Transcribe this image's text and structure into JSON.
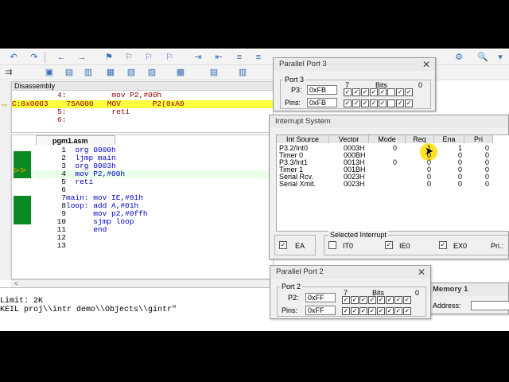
{
  "disassembly": {
    "title": "Disassembly",
    "lines": [
      {
        "text": "          4:          mov P2,#00h"
      },
      {
        "text": "C:0x0003    75A000   MOV       P2(0xA0"
      },
      {
        "text": "          5:          reti"
      },
      {
        "text": "          6:"
      }
    ]
  },
  "editor": {
    "tab_label": "pgm1.asm",
    "lines": [
      {
        "num": "1",
        "code": "  org 0000h"
      },
      {
        "num": "2",
        "code": "  ljmp main"
      },
      {
        "num": "3",
        "code": "  org 0003h"
      },
      {
        "num": "4",
        "code": "  mov P2,#00h"
      },
      {
        "num": "5",
        "code": "  reti"
      },
      {
        "num": "6",
        "code": ""
      },
      {
        "num": "7",
        "code": "main: mov IE,#81h"
      },
      {
        "num": "8",
        "code": "loop: add A,#01h"
      },
      {
        "num": "9",
        "code": "      mov p2,#0ffh"
      },
      {
        "num": "10",
        "code": "      sjmp loop"
      },
      {
        "num": "11",
        "code": "      end"
      },
      {
        "num": "12",
        "code": ""
      },
      {
        "num": "13",
        "code": ""
      }
    ]
  },
  "output": {
    "lines": [
      {
        "text": "Limit: 2K"
      },
      {
        "text": "KEIL proj\\\\intr demo\\\\Objects\\\\gintr\""
      }
    ]
  },
  "port3": {
    "title": "Parallel Port 3",
    "group": "Port 3",
    "reg_label": "P3:",
    "reg_value": "0xFB",
    "pins_label": "Pins:",
    "pins_value": "0xFB",
    "bits_hi": "7",
    "bits_label": "Bits",
    "bits_lo": "0",
    "reg_bits": [
      "✓",
      "✓",
      "✓",
      "✓",
      "✓",
      "",
      "✓",
      "✓"
    ],
    "pin_bits": [
      "✓",
      "✓",
      "✓",
      "✓",
      "✓",
      "",
      "✓",
      "✓"
    ]
  },
  "interrupts": {
    "title": "Interrupt System",
    "columns": [
      "Int Source",
      "Vector",
      "Mode",
      "Req",
      "Ena",
      "Pri"
    ],
    "rows": [
      {
        "source": "P3.2/Int0",
        "vector": "0003H",
        "mode": "0",
        "req": "1",
        "ena": "1",
        "pri": "0"
      },
      {
        "source": "Timer 0",
        "vector": "000BH",
        "mode": "",
        "req": "0",
        "ena": "0",
        "pri": "0"
      },
      {
        "source": "P3.3/Int1",
        "vector": "0013H",
        "mode": "0",
        "req": "0",
        "ena": "0",
        "pri": "0"
      },
      {
        "source": "Timer 1",
        "vector": "001BH",
        "mode": "",
        "req": "0",
        "ena": "0",
        "pri": "0"
      },
      {
        "source": "Serial Rcv.",
        "vector": "0023H",
        "mode": "",
        "req": "0",
        "ena": "0",
        "pri": "0"
      },
      {
        "source": "Serial Xmit.",
        "vector": "0023H",
        "mode": "",
        "req": "0",
        "ena": "0",
        "pri": "0"
      }
    ],
    "ea_label": "EA",
    "selected_label": "Selected Interrupt",
    "it0_label": "IT0",
    "ie0_label": "IE0",
    "ex0_label": "EX0",
    "pri_label": "Pri.:"
  },
  "port2": {
    "title": "Parallel Port 2",
    "group": "Port 2",
    "reg_label": "P2:",
    "reg_value": "0xFF",
    "pins_label": "Pins:",
    "pins_value": "0xFF",
    "bits_hi": "7",
    "bits_label": "Bits",
    "bits_lo": "0",
    "reg_bits": [
      "✓",
      "✓",
      "✓",
      "✓",
      "✓",
      "✓",
      "✓",
      "✓"
    ],
    "pin_bits": [
      "✓",
      "✓",
      "✓",
      "✓",
      "✓",
      "✓",
      "✓",
      "✓"
    ]
  },
  "memory": {
    "title": "Memory 1",
    "address_label": "Address:"
  },
  "colors": {
    "highlight": "#ffff40",
    "breakpoint_green": "#0a8a24",
    "keyword_blue": "#0000c8"
  }
}
